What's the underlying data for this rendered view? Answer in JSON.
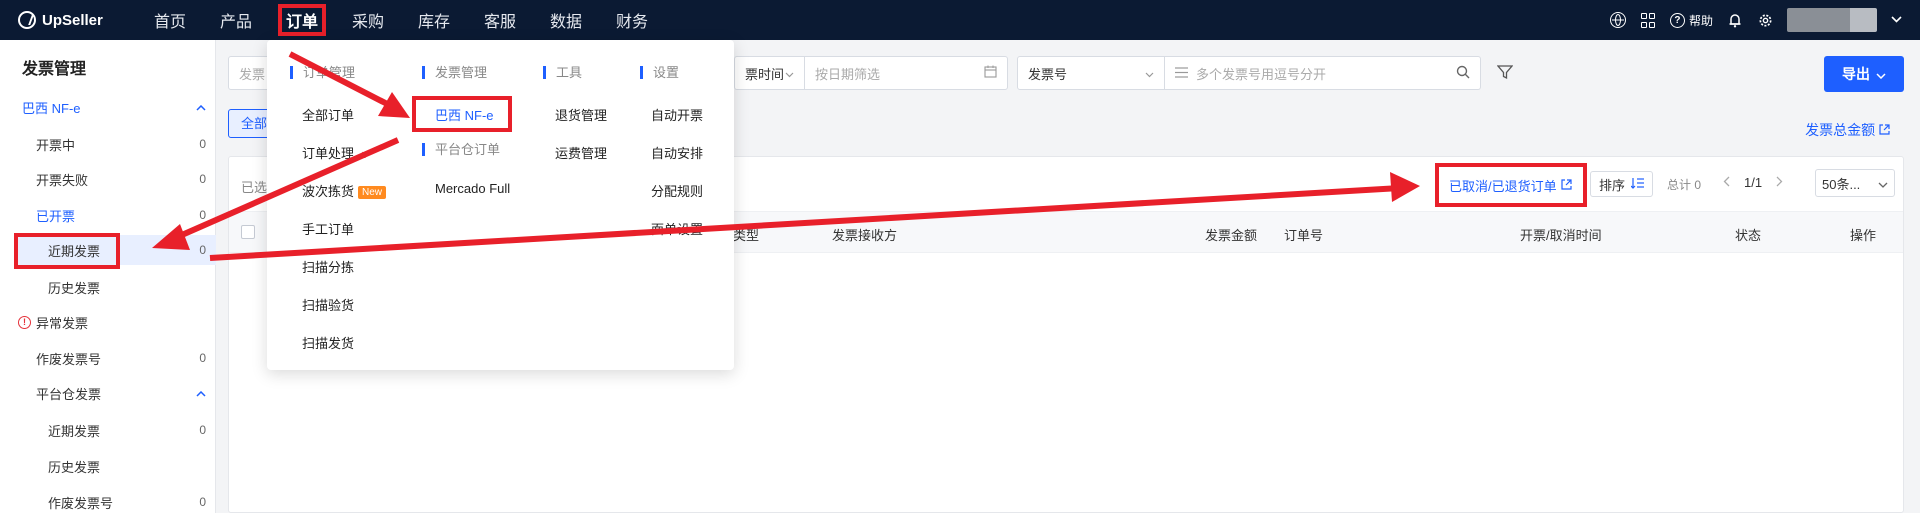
{
  "topbar": {
    "brand": "UpSeller",
    "nav": [
      "首页",
      "产品",
      "订单",
      "采购",
      "库存",
      "客服",
      "数据",
      "财务"
    ],
    "help": "帮助"
  },
  "sidebar": {
    "title": "发票管理",
    "brazil_group": "巴西 NF-e",
    "issuing": {
      "label": "开票中",
      "count": "0"
    },
    "failed": {
      "label": "开票失败",
      "count": "0"
    },
    "issued": {
      "label": "已开票",
      "count": "0"
    },
    "recent": {
      "label": "近期发票",
      "count": "0"
    },
    "history": {
      "label": "历史发票"
    },
    "abnormal": {
      "label": "异常发票"
    },
    "void_no": {
      "label": "作废发票号",
      "count": "0"
    },
    "platform_group": {
      "label": "平台仓发票"
    },
    "p_recent": {
      "label": "近期发票",
      "count": "0"
    },
    "p_history": {
      "label": "历史发票"
    },
    "p_void": {
      "label": "作废发票号",
      "count": "0"
    }
  },
  "filters": {
    "invoice_prefix": "发票",
    "time_label": "票时间",
    "date_placeholder": "按日期筛选",
    "field_select": "发票号",
    "search_placeholder": "多个发票号用逗号分开"
  },
  "export_label": "导出",
  "tab_all": "全部",
  "total_amount": "发票总金额",
  "toolbar": {
    "selected": "已选",
    "cancel_link": "已取消/已退货订单",
    "sort": "排序",
    "total": "总计 0",
    "page": "1/1",
    "per_page": "50条..."
  },
  "table_headers": [
    "类型",
    "发票接收方",
    "发票金额",
    "订单号",
    "开票/取消时间",
    "状态",
    "操作"
  ],
  "dropdown": {
    "col1_head": "订单管理",
    "col1": [
      "全部订单",
      "订单处理",
      "波次拣货",
      "手工订单",
      "扫描分拣",
      "扫描验货",
      "扫描发货"
    ],
    "new_badge": "New",
    "col2_head": "发票管理",
    "col2_item": "巴西 NF-e",
    "col2_head2": "平台仓订单",
    "col2_item2": "Mercado Full",
    "col3_head": "工具",
    "col3": [
      "退货管理",
      "运费管理"
    ],
    "col4_head": "设置",
    "col4": [
      "自动开票",
      "自动安排",
      "分配规则",
      "面单设置"
    ]
  },
  "colors": {
    "accent": "#1e5fff",
    "annotation": "#e8202a",
    "nav_bg": "#0b1a33"
  }
}
